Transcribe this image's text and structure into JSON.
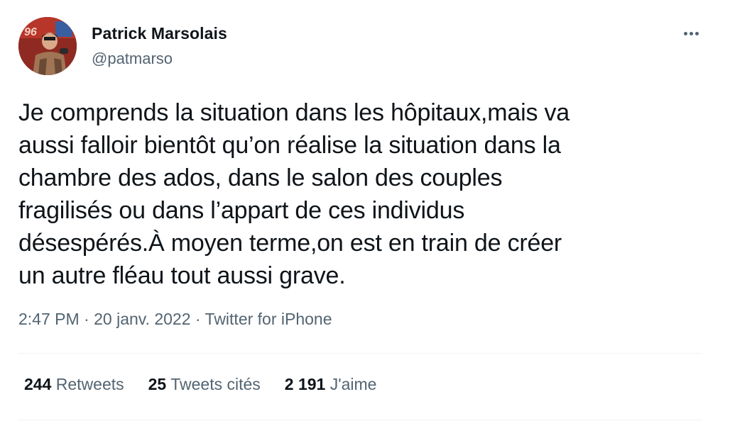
{
  "author": {
    "display_name": "Patrick Marsolais",
    "handle": "@patmarso"
  },
  "tweet": {
    "text": "Je comprends la situation dans les hôpitaux,mais va\naussi falloir bientôt qu’on réalise la situation dans la\nchambre des ados, dans le salon des couples\nfragilisés ou dans l’appart de ces individus\ndésespérés.À moyen terme,on est en train de créer\nun autre fléau tout aussi grave.",
    "time": "2:47 PM",
    "date": "20 janv. 2022",
    "source": "Twitter for iPhone",
    "separator": " · "
  },
  "stats": {
    "retweets_count": "244",
    "retweets_label": "Retweets",
    "quotes_count": "25",
    "quotes_label": "Tweets cités",
    "likes_count": "2 191",
    "likes_label": "J'aime"
  },
  "icons": {
    "avatar": "profile-photo",
    "more": "more-options-icon"
  },
  "colors": {
    "primary_text": "#0f1419",
    "secondary_text": "#536471",
    "divider": "#eff3f4"
  }
}
